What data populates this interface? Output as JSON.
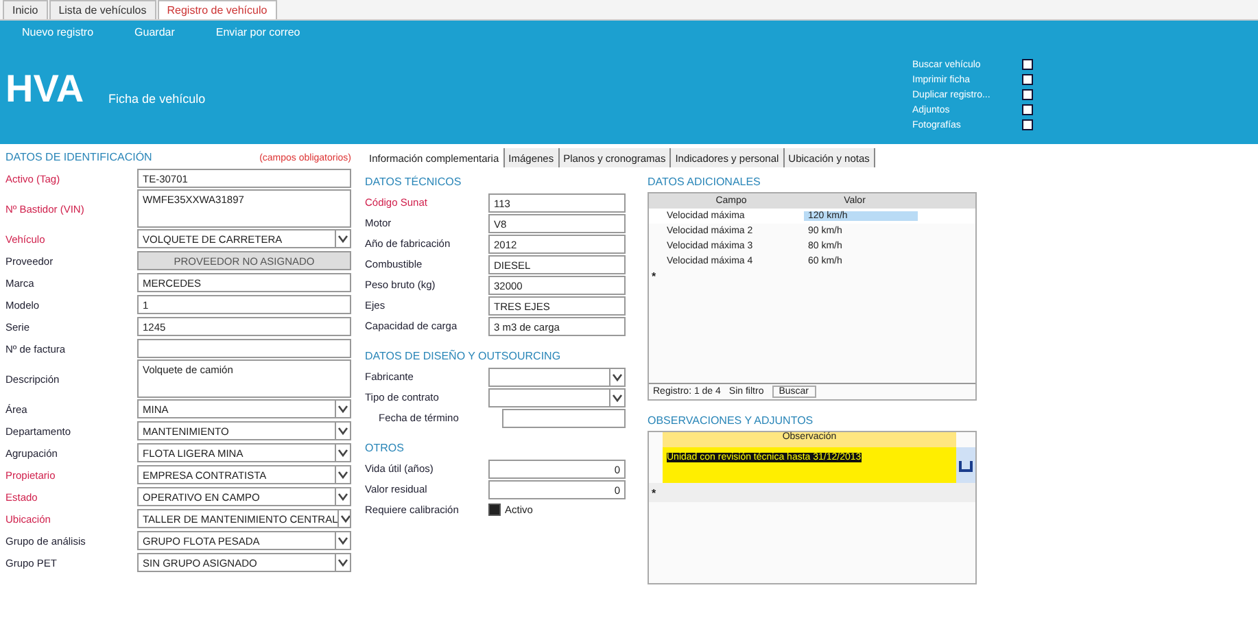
{
  "doc_tabs": [
    {
      "label": "Inicio",
      "selected": false
    },
    {
      "label": "Lista de vehículos",
      "selected": false
    },
    {
      "label": "Registro de vehículo",
      "selected": true
    }
  ],
  "toolbar": [
    "Nuevo registro",
    "Guardar",
    "Enviar por correo"
  ],
  "header": {
    "logo": "HVA",
    "subtitle": "Ficha de vehículo"
  },
  "options": [
    {
      "label": "Buscar vehículo",
      "checked": false
    },
    {
      "label": "Imprimir ficha",
      "checked": false
    },
    {
      "label": "Duplicar registro...",
      "checked": false
    },
    {
      "label": "Adjuntos",
      "checked": false
    },
    {
      "label": "Fotografías",
      "checked": false
    }
  ],
  "identification": {
    "title": "DATOS DE IDENTIFICACIÓN",
    "note": "(campos obligatorios)",
    "fields": [
      {
        "label": "Activo (Tag)",
        "value": "TE-30701",
        "kind": "text",
        "required": true
      },
      {
        "label": "Nº Bastidor (VIN)",
        "value": "WMFE35XXWA31897",
        "kind": "textarea",
        "required": true
      },
      {
        "label": "Vehículo",
        "value": "VOLQUETE DE CARRETERA",
        "kind": "select",
        "required": true
      },
      {
        "label": "Proveedor",
        "value": "PROVEEDOR NO ASIGNADO",
        "kind": "readonly",
        "required": false
      },
      {
        "label": "Marca",
        "value": "MERCEDES",
        "kind": "text",
        "required": false
      },
      {
        "label": "Modelo",
        "value": "1",
        "kind": "text",
        "required": false
      },
      {
        "label": "Serie",
        "value": "1245",
        "kind": "text",
        "required": false
      },
      {
        "label": "Nº de factura",
        "kind": "text",
        "required": false
      },
      {
        "label": "Descripción",
        "value": "Volquete de camión",
        "kind": "textarea",
        "required": false
      },
      {
        "label": "Área",
        "value": "MINA",
        "kind": "select",
        "required": false
      },
      {
        "label": "Departamento",
        "value": "MANTENIMIENTO",
        "kind": "select",
        "required": false
      },
      {
        "label": "Agrupación",
        "value": "FLOTA LIGERA MINA",
        "kind": "select",
        "required": false
      },
      {
        "label": "Propietario",
        "value": "EMPRESA CONTRATISTA",
        "kind": "select",
        "required": true
      },
      {
        "label": "Estado",
        "value": "OPERATIVO EN CAMPO",
        "kind": "select",
        "required": true
      },
      {
        "label": "Ubicación",
        "value": "TALLER DE MANTENIMIENTO CENTRAL",
        "kind": "select",
        "required": true
      },
      {
        "label": "Grupo de análisis",
        "value": "GRUPO FLOTA PESADA",
        "kind": "select",
        "required": false
      },
      {
        "label": "Grupo PET",
        "value": "SIN GRUPO ASIGNADO",
        "kind": "select",
        "required": false
      }
    ]
  },
  "sub_tabs": [
    {
      "label": "Información complementaria",
      "selected": true
    },
    {
      "label": "Imágenes",
      "selected": false
    },
    {
      "label": "Planos y cronogramas",
      "selected": false
    },
    {
      "label": "Indicadores y personal",
      "selected": false
    },
    {
      "label": "Ubicación y notas",
      "selected": false
    }
  ],
  "technical": {
    "title": "DATOS TÉCNICOS",
    "fields": [
      {
        "label": "Código Sunat",
        "value": "113",
        "required": true
      },
      {
        "label": "Motor",
        "value": "V8",
        "required": false
      },
      {
        "label": "Año de fabricación",
        "value": "2012",
        "required": false
      },
      {
        "label": "Combustible",
        "value": "DIESEL",
        "required": false
      },
      {
        "label": "Peso bruto (kg)",
        "value": "32000",
        "required": false
      },
      {
        "label": "Ejes",
        "value": "TRES EJES",
        "required": false
      },
      {
        "label": "Capacidad de carga",
        "value": "3 m3 de carga",
        "required": false
      }
    ]
  },
  "design": {
    "title": "DATOS DE DISEÑO Y OUTSOURCING",
    "fields": [
      {
        "label": "Fabricante",
        "kind": "select"
      },
      {
        "label": "Tipo de contrato",
        "kind": "select"
      },
      {
        "label": "Fecha de término",
        "kind": "text"
      }
    ]
  },
  "others": {
    "title": "OTROS",
    "fields": [
      {
        "label": "Vida útil (años)",
        "value": "0"
      },
      {
        "label": "Valor residual",
        "value": "0"
      }
    ],
    "calibration": {
      "label": "Requiere calibración",
      "option": "Activo",
      "checked": true
    }
  },
  "additional": {
    "title": "DATOS ADICIONALES",
    "columns": [
      "Campo",
      "Valor"
    ],
    "rows": [
      {
        "field": "Velocidad máxima",
        "value": "120 km/h",
        "selected": true
      },
      {
        "field": "Velocidad máxima 2",
        "value": "90 km/h",
        "selected": false
      },
      {
        "field": "Velocidad máxima 3",
        "value": "80 km/h",
        "selected": false
      },
      {
        "field": "Velocidad máxima 4",
        "value": "60 km/h",
        "selected": false
      }
    ],
    "new_row_marker": "*",
    "navigator": {
      "record": "Registro: 1 de 4",
      "filter": "Sin filtro",
      "search": "Buscar"
    }
  },
  "observations": {
    "title": "OBSERVACIONES Y ADJUNTOS",
    "column": "Observación",
    "rows": [
      {
        "text": "Unidad con revisión técnica hasta 31/12/2013",
        "selected": true
      }
    ],
    "new_row_marker": "*"
  }
}
